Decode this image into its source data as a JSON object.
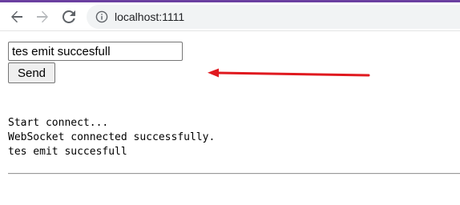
{
  "browser": {
    "url": "localhost:1111",
    "icons": {
      "back": "arrow-left-icon",
      "forward": "arrow-right-icon",
      "reload": "reload-icon",
      "site_info": "info-icon"
    },
    "accent_color": "#6b3fa0"
  },
  "form": {
    "input_value": "tes emit succesfull",
    "send_label": "Send"
  },
  "log": {
    "lines": [
      "Start connect...",
      "WebSocket connected successfully.",
      "tes emit succesfull"
    ]
  },
  "annotation": {
    "arrow_color": "#e0191f"
  }
}
